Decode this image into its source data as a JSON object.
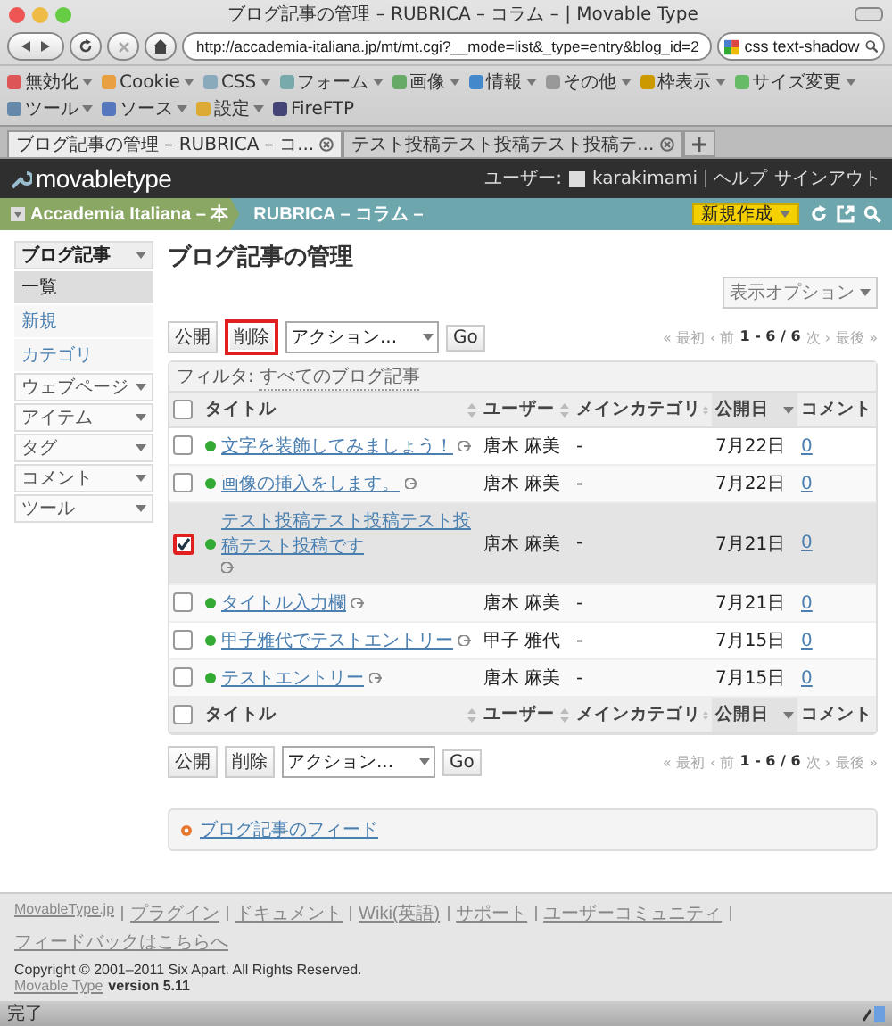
{
  "window": {
    "title": "ブログ記事の管理 – RUBRICA – コラム – | Movable Type"
  },
  "nav": {
    "url": "http://accademia-italiana.jp/mt/mt.cgi?__mode=list&_type=entry&blog_id=2",
    "search": "css text-shadow"
  },
  "toolbar": [
    {
      "label": "無効化",
      "has_menu": true
    },
    {
      "label": "Cookie",
      "has_menu": true
    },
    {
      "label": "CSS",
      "has_menu": true
    },
    {
      "label": "フォーム",
      "has_menu": true
    },
    {
      "label": "画像",
      "has_menu": true
    },
    {
      "label": "情報",
      "has_menu": true
    },
    {
      "label": "その他",
      "has_menu": true
    },
    {
      "label": "枠表示",
      "has_menu": true
    },
    {
      "label": "サイズ変更",
      "has_menu": true
    },
    {
      "label": "ツール",
      "has_menu": true
    },
    {
      "label": "ソース",
      "has_menu": true
    },
    {
      "label": "設定",
      "has_menu": true
    },
    {
      "label": "FireFTP",
      "has_menu": false
    }
  ],
  "tabs": [
    {
      "label": "ブログ記事の管理 – RUBRICA – コ...",
      "selected": true
    },
    {
      "label": "テスト投稿テスト投稿テスト投稿テ...",
      "selected": false
    }
  ],
  "mt_header": {
    "logo": "movabletype",
    "user_label": "ユーザー:",
    "user": "karakimami",
    "links": [
      "ヘルプ",
      "サインアウト"
    ]
  },
  "blog_bar": {
    "site": "Accademia Italiana – 本",
    "blog": "RUBRICA – コラム –",
    "new_button": "新規作成"
  },
  "sidebar": [
    {
      "label": "ブログ記事",
      "expanded": true,
      "items": [
        {
          "label": "一覧",
          "selected": true
        },
        {
          "label": "新規",
          "selected": false
        },
        {
          "label": "カテゴリ",
          "selected": false
        }
      ]
    },
    {
      "label": "ウェブページ",
      "expanded": false
    },
    {
      "label": "アイテム",
      "expanded": false
    },
    {
      "label": "タグ",
      "expanded": false
    },
    {
      "label": "コメント",
      "expanded": false
    },
    {
      "label": "ツール",
      "expanded": false
    }
  ],
  "page_title": "ブログ記事の管理",
  "display_options": "表示オプション",
  "action_bars": [
    {
      "buttons": [
        {
          "label": "公開",
          "highlighted": false
        },
        {
          "label": "削除",
          "highlighted": true
        }
      ],
      "select": "アクション...",
      "go": "Go",
      "pager": {
        "first": "« 最初",
        "prev": "‹ 前",
        "range": "1 - 6 / 6",
        "next": "次 ›",
        "last": "最後 »"
      }
    },
    {
      "buttons": [
        {
          "label": "公開",
          "highlighted": false
        },
        {
          "label": "削除",
          "highlighted": false
        }
      ],
      "select": "アクション...",
      "go": "Go",
      "pager": {
        "first": "« 最初",
        "prev": "‹ 前",
        "range": "1 - 6 / 6",
        "next": "次 ›",
        "last": "最後 »"
      }
    }
  ],
  "filter": {
    "label": "フィルタ:",
    "value": "すべてのブログ記事"
  },
  "header_row": {
    "select_all_checked": false,
    "columns": [
      {
        "label": "タイトル",
        "sorted": false
      },
      {
        "label": "ユーザー",
        "sorted": false
      },
      {
        "label": "メインカテゴリ",
        "sorted": false
      },
      {
        "label": "公開日",
        "sorted": true
      },
      {
        "label": "コメント",
        "sorted": false
      }
    ]
  },
  "rows": [
    {
      "title": "文字を装飾してみましょう！",
      "user": "唐木 麻美",
      "category": "-",
      "date": "7月22日",
      "comments": "0",
      "checked": false,
      "marked": false
    },
    {
      "title": "画像の挿入をします。",
      "user": "唐木 麻美",
      "category": "-",
      "date": "7月22日",
      "comments": "0",
      "checked": false,
      "marked": false
    },
    {
      "title": "テスト投稿テスト投稿テスト投稿テスト投稿です",
      "user": "唐木 麻美",
      "category": "-",
      "date": "7月21日",
      "comments": "0",
      "checked": true,
      "marked": true
    },
    {
      "title": "タイトル入力欄",
      "user": "唐木 麻美",
      "category": "-",
      "date": "7月21日",
      "comments": "0",
      "checked": false,
      "marked": false
    },
    {
      "title": "甲子雅代でテストエントリー",
      "user": "甲子 雅代",
      "category": "-",
      "date": "7月15日",
      "comments": "0",
      "checked": false,
      "marked": false
    },
    {
      "title": "テストエントリー",
      "user": "唐木 麻美",
      "category": "-",
      "date": "7月15日",
      "comments": "0",
      "checked": false,
      "marked": false
    }
  ],
  "footer_row": {
    "select_all_checked": false,
    "columns": [
      {
        "label": "タイトル",
        "sorted": false
      },
      {
        "label": "ユーザー",
        "sorted": false
      },
      {
        "label": "メインカテゴリ",
        "sorted": false
      },
      {
        "label": "公開日",
        "sorted": true
      },
      {
        "label": "コメント",
        "sorted": false
      }
    ]
  },
  "feed_link": "ブログ記事のフィード",
  "footer": {
    "links": [
      "MovableType.jp",
      "プラグイン",
      "ドキュメント",
      "Wiki(英語)",
      "サポート",
      "ユーザーコミュニティ",
      "フィードバックはこちらへ"
    ],
    "copyright": "Copyright © 2001–2011 Six Apart. All Rights Reserved.",
    "product_link": "Movable Type",
    "version": "version 5.11"
  },
  "status_bar": "完了"
}
